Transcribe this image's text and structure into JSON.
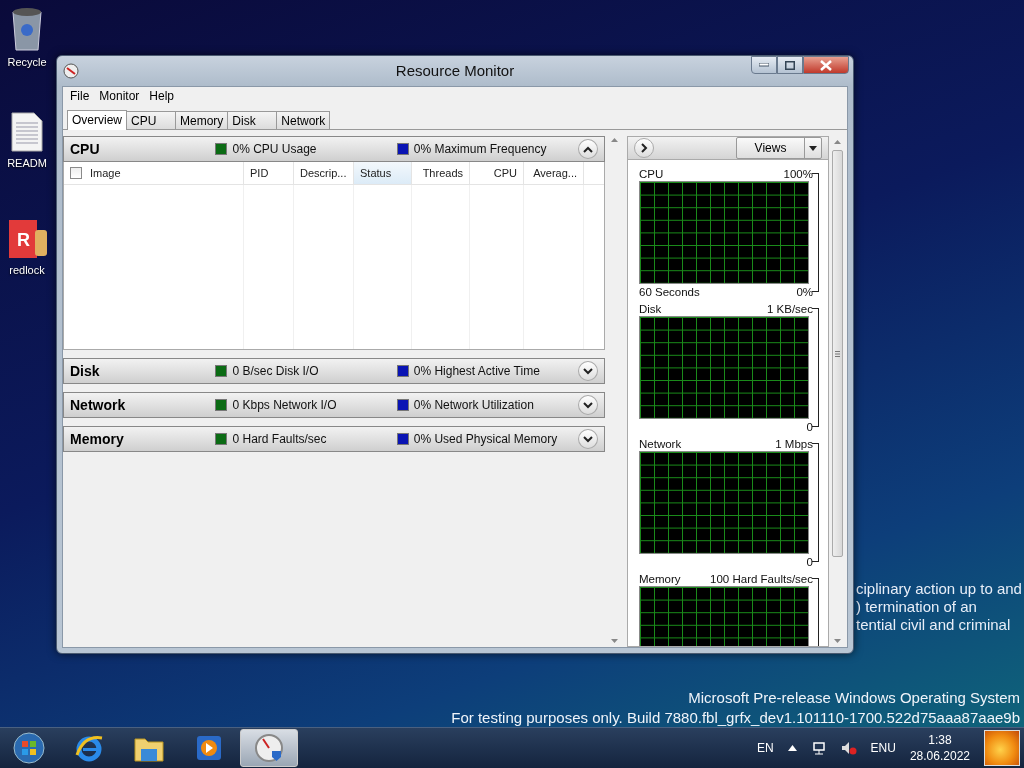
{
  "desktop": {
    "icons": [
      {
        "label": "Recycle",
        "kind": "bin"
      },
      {
        "label": "READM",
        "kind": "document"
      },
      {
        "label": "redlock",
        "kind": "app",
        "icon_text": "R"
      }
    ],
    "notice_lines": [
      "ciplinary action up to and",
      ") termination of an",
      "tential civil and criminal"
    ],
    "build_notice": [
      "Microsoft Pre-release Windows Operating System",
      "For testing purposes only. Build 7880.fbl_grfx_dev1.101110-1700.522d75aaa87aae9b"
    ]
  },
  "window": {
    "title": "Resource Monitor",
    "menu": [
      "File",
      "Monitor",
      "Help"
    ],
    "tabs": [
      {
        "label": "Overview",
        "selected": true
      },
      {
        "label": "CPU",
        "selected": false
      },
      {
        "label": "Memory",
        "selected": false
      },
      {
        "label": "Disk",
        "selected": false
      },
      {
        "label": "Network",
        "selected": false
      }
    ],
    "sections": [
      {
        "title": "CPU",
        "expanded": true,
        "metrics": [
          {
            "text": "0% CPU Usage",
            "color": "#0b6b14"
          },
          {
            "text": "0% Maximum Frequency",
            "color": "#0a14b4"
          }
        ]
      },
      {
        "title": "Disk",
        "expanded": false,
        "metrics": [
          {
            "text": "0 B/sec Disk I/O",
            "color": "#0b6b14"
          },
          {
            "text": "0% Highest Active Time",
            "color": "#0a14b4"
          }
        ]
      },
      {
        "title": "Network",
        "expanded": false,
        "metrics": [
          {
            "text": "0 Kbps Network I/O",
            "color": "#0b6b14"
          },
          {
            "text": "0% Network Utilization",
            "color": "#0a14b4"
          }
        ]
      },
      {
        "title": "Memory",
        "expanded": false,
        "metrics": [
          {
            "text": "0 Hard Faults/sec",
            "color": "#0b6b14"
          },
          {
            "text": "0% Used Physical Memory",
            "color": "#0a14b4"
          }
        ]
      }
    ],
    "cpu_table": {
      "select_all_checked": false,
      "columns": [
        {
          "label": "Image",
          "selected": false
        },
        {
          "label": "PID",
          "selected": false
        },
        {
          "label": "Descrip...",
          "selected": false
        },
        {
          "label": "Status",
          "selected": true
        },
        {
          "label": "Threads",
          "selected": false
        },
        {
          "label": "CPU",
          "selected": false
        },
        {
          "label": "Averag...",
          "selected": false
        }
      ]
    },
    "views_button": "Views",
    "graphs": [
      {
        "title": "CPU",
        "max": "100%",
        "footer_left": "60 Seconds",
        "min": "0%"
      },
      {
        "title": "Disk",
        "max": "1 KB/sec",
        "min": "0"
      },
      {
        "title": "Network",
        "max": "1 Mbps",
        "min": "0"
      },
      {
        "title": "Memory",
        "max": "100 Hard Faults/sec"
      }
    ]
  },
  "taskbar": {
    "pinned": [
      {
        "kind": "browser",
        "selected": false
      },
      {
        "kind": "folder",
        "selected": false
      },
      {
        "kind": "media",
        "selected": false
      },
      {
        "kind": "gauge",
        "selected": true
      }
    ],
    "input_language": "EN",
    "keyboard": "ENU",
    "time": "1:38",
    "date": "28.06.2022"
  }
}
